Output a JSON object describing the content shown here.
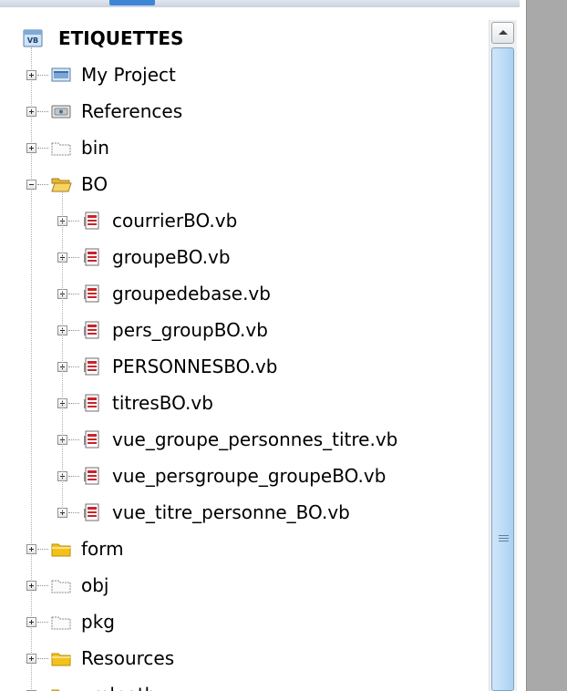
{
  "solution_explorer": {
    "root": {
      "label": "ETIQUETTES",
      "icon": "vb-project-icon"
    },
    "items": [
      {
        "label": "My Project",
        "icon": "my-project-icon",
        "expander": "plus",
        "level": 1
      },
      {
        "label": "References",
        "icon": "references-icon",
        "expander": "plus",
        "level": 1
      },
      {
        "label": "bin",
        "icon": "folder-outline-icon",
        "expander": "plus",
        "level": 1
      },
      {
        "label": "BO",
        "icon": "folder-open-icon",
        "expander": "minus",
        "level": 1
      },
      {
        "label": "courrierBO.vb",
        "icon": "vb-file-icon",
        "expander": "plus",
        "level": 2
      },
      {
        "label": "groupeBO.vb",
        "icon": "vb-file-icon",
        "expander": "plus",
        "level": 2
      },
      {
        "label": "groupedebase.vb",
        "icon": "vb-file-icon",
        "expander": "plus",
        "level": 2
      },
      {
        "label": "pers_groupBO.vb",
        "icon": "vb-file-icon",
        "expander": "plus",
        "level": 2
      },
      {
        "label": "PERSONNESBO.vb",
        "icon": "vb-file-icon",
        "expander": "plus",
        "level": 2
      },
      {
        "label": "titresBO.vb",
        "icon": "vb-file-icon",
        "expander": "plus",
        "level": 2
      },
      {
        "label": "vue_groupe_personnes_titre.vb",
        "icon": "vb-file-icon",
        "expander": "plus",
        "level": 2
      },
      {
        "label": "vue_persgroupe_groupeBO.vb",
        "icon": "vb-file-icon",
        "expander": "plus",
        "level": 2
      },
      {
        "label": "vue_titre_personne_BO.vb",
        "icon": "vb-file-icon",
        "expander": "plus",
        "level": 2
      },
      {
        "label": "form",
        "icon": "folder-yellow-icon",
        "expander": "plus",
        "level": 1
      },
      {
        "label": "obj",
        "icon": "folder-outline-icon",
        "expander": "plus",
        "level": 1
      },
      {
        "label": "pkg",
        "icon": "folder-outline-icon",
        "expander": "plus",
        "level": 1
      },
      {
        "label": "Resources",
        "icon": "folder-yellow-icon",
        "expander": "plus",
        "level": 1
      },
      {
        "label": "xmlpath",
        "icon": "folder-yellow-icon",
        "expander": "plus",
        "level": 1
      }
    ]
  },
  "colors": {
    "scroll_thumb": "#bcdcf6",
    "side_pane": "#a9a9a9",
    "folder_yellow": "#f3c21a"
  }
}
